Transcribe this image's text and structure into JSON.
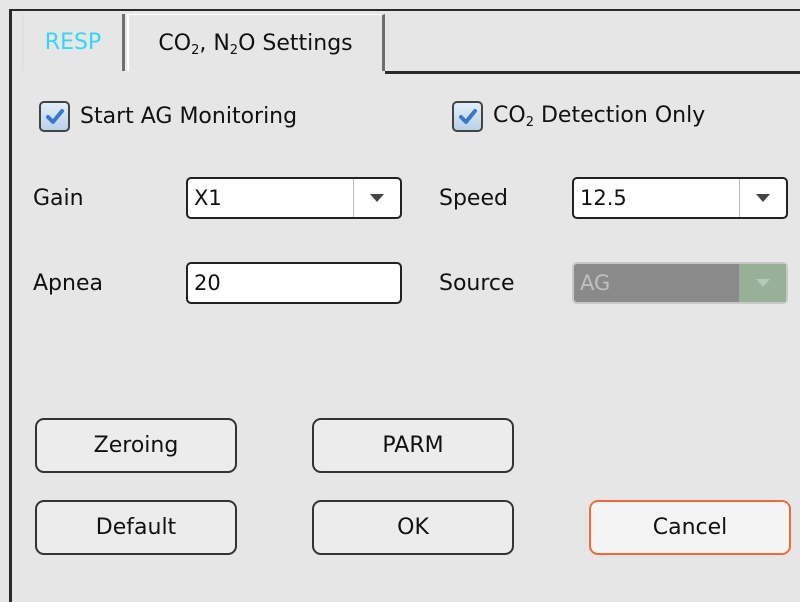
{
  "tabs": {
    "resp": "RESP",
    "co2_settings": {
      "co2": "CO",
      "sub2": "2",
      "n2o_n": ", N",
      "n2o_o": "O Settings"
    }
  },
  "checkboxes": {
    "start_ag": {
      "label": "Start AG Monitoring",
      "checked": true
    },
    "co2_only": {
      "label_prefix": "CO",
      "label_sub": "2",
      "label_suffix": " Detection Only",
      "checked": true
    }
  },
  "fields": {
    "gain": {
      "label": "Gain",
      "value": "X1"
    },
    "speed": {
      "label": "Speed",
      "value": "12.5"
    },
    "apnea": {
      "label": "Apnea",
      "value": "20"
    },
    "source": {
      "label": "Source",
      "value": "AG",
      "disabled": true
    }
  },
  "buttons": {
    "zeroing": "Zeroing",
    "parm": "PARM",
    "default": "Default",
    "ok": "OK",
    "cancel": "Cancel"
  },
  "colors": {
    "active_tab": "#33d6f5",
    "focus_border": "#f06a3a",
    "background": "#e6e6e6"
  }
}
